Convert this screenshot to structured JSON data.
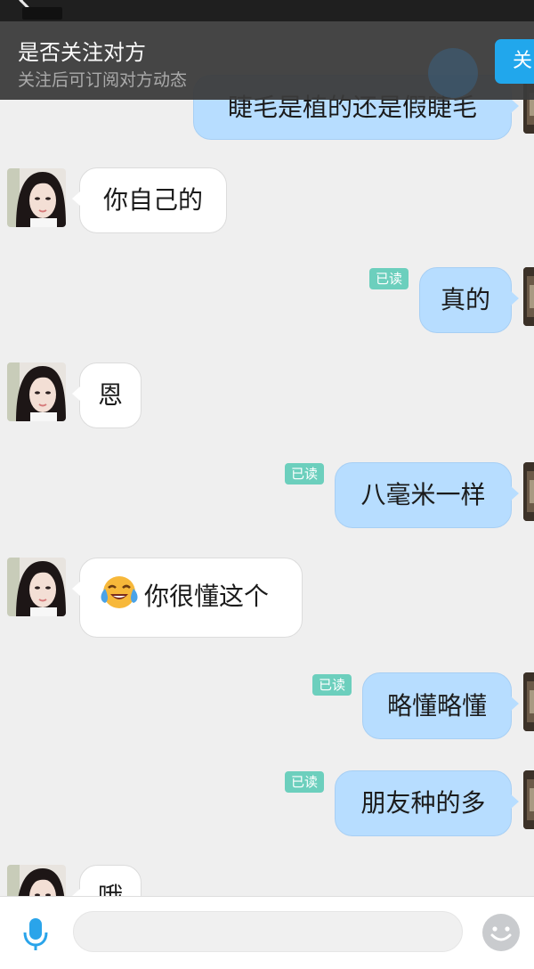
{
  "header": {
    "back_icon": "chevron-left-icon"
  },
  "follow_banner": {
    "title": "是否关注对方",
    "subtitle": "关注后可订阅对方动态",
    "follow_button": "关"
  },
  "messages": [
    {
      "side": "right",
      "text": "睫毛是植的还是假睫毛",
      "read": ""
    },
    {
      "side": "left",
      "text": "你自己的"
    },
    {
      "side": "right",
      "text": "真的",
      "read": "已读"
    },
    {
      "side": "left",
      "text": "恩"
    },
    {
      "side": "right",
      "text": "八毫米一样",
      "read": "已读"
    },
    {
      "side": "left",
      "text": "你很懂这个",
      "emoji": "laughing-tears-icon"
    },
    {
      "side": "right",
      "text": "略懂略懂",
      "read": "已读"
    },
    {
      "side": "right",
      "text": "朋友种的多",
      "read": "已读"
    },
    {
      "side": "left",
      "text": "哦"
    }
  ],
  "input_bar": {
    "mic_icon": "microphone-icon",
    "input_placeholder": "",
    "emoji_icon": "smiley-face-icon"
  },
  "colors": {
    "right_bubble": "#b7ddff",
    "left_bubble": "#ffffff",
    "read_badge": "#6ccfbd",
    "follow_button": "#21a7ec",
    "banner": "#3a3a3a",
    "background": "#efefef"
  }
}
